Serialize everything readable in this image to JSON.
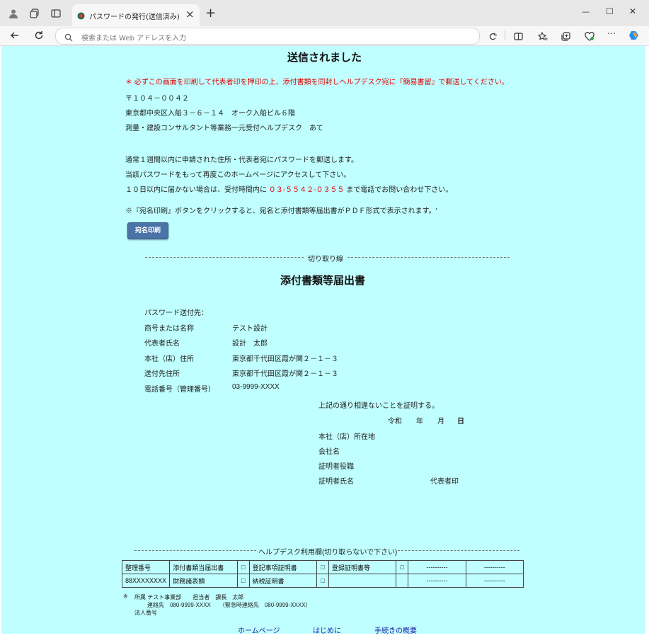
{
  "browser": {
    "tab_title": "パスワードの発行(送信済み)",
    "tab_close": "×",
    "new_tab": "+",
    "address_placeholder": "検索または Web アドレスを入力",
    "window_minimize": "—",
    "window_maximize": "☐",
    "window_close": "✕"
  },
  "page": {
    "title": "送信されました",
    "notice": "＊ 必ずこの画面を印刷して代表者印を押印の上、添付書類を同封しヘルプデスク宛に『簡易書留』で郵送してください。",
    "address_lines": [
      "〒１０４－００４２",
      "東京都中央区入船３－６－１４　オーク入船ビル６階",
      "測量・建設コンサルタント等業務一元受付ヘルプデスク　あて"
    ],
    "info_line1": "通常１週間以内に申請された住所・代表者宛にパスワードを郵送します。",
    "info_line2": "当該パスワードをもって再度このホームページにアクセスして下さい。",
    "info_line3_prefix": "１０日以内に届かない場合は、受付時間内に",
    "info_line3_phone": "０３-５５４２-０３５５",
    "info_line3_suffix": "まで電話でお問い合わせ下さい。",
    "print_note": "※『宛名印刷』ボタンをクリックすると、宛名と添付書類等届出書がＰＤＦ形式で表示されます。'",
    "print_button": "宛名印刷",
    "cut_label": "切り取り線",
    "form_title": "添付書類等届出書",
    "form": {
      "heading": "パスワード送付先：",
      "rows": [
        {
          "label": "商号または名称",
          "value": "テスト設計"
        },
        {
          "label": "代表者氏名",
          "value": "設計　太郎"
        },
        {
          "label": "本社（店）住所",
          "value": "東京都千代田区霞が関２－１－３"
        },
        {
          "label": "送付先住所",
          "value": "東京都千代田区霞が関２－１－３"
        },
        {
          "label": "電話番号（管理番号）",
          "value": "03-9999-XXXX"
        }
      ]
    },
    "certify": {
      "statement": "上記の通り相違ないことを証明する。",
      "era": "令和",
      "year": "年",
      "month": "月",
      "day": "日",
      "location": "本社（店）所在地",
      "company": "会社名",
      "title": "証明者役職",
      "name": "証明者氏名",
      "seal": "代表者印"
    },
    "helpdesk_label": "ヘルプデスク利用欄(切り取らないで下さい)",
    "table": {
      "row1": [
        "整理番号",
        "添付書類当届出書",
        "□",
        "登記事項証明書",
        "□",
        "登録証明書等",
        "□",
        "----------",
        "----------"
      ],
      "row2": [
        "88XXXXXXXX",
        "財務諸表類",
        "□",
        "納税証明書",
        "□",
        "",
        "",
        "----------",
        "----------"
      ]
    },
    "footnote_mark": "※",
    "footnote_line1": "所属 テスト事業部　　担当者　課長　太郎",
    "footnote_line2": "連絡先　080-9999-XXXX　　（緊急時連絡先　080-9999-XXXX）",
    "footnote_line3": "法人番号",
    "links": [
      "ホームページ",
      "はじめに",
      "手続きの概要"
    ]
  }
}
